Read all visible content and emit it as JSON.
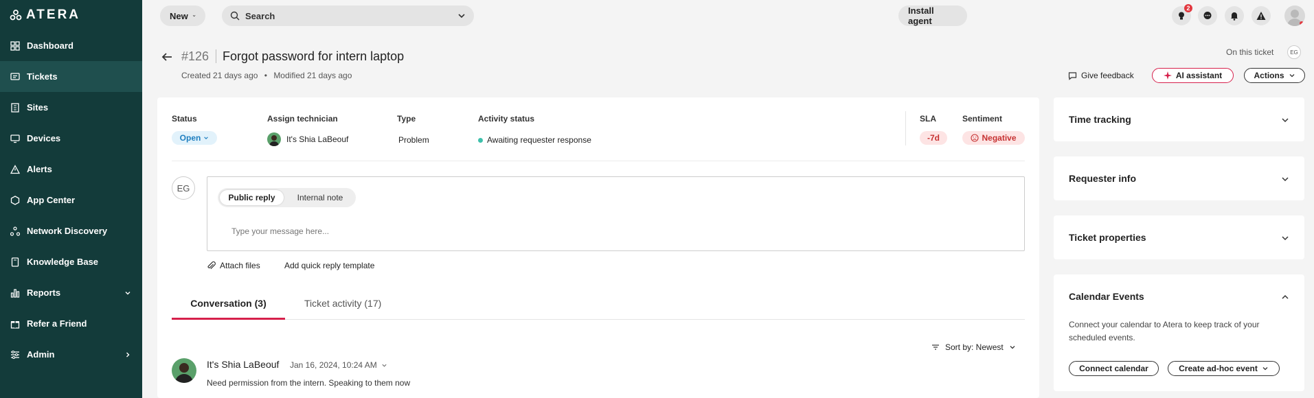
{
  "sidebar": {
    "logo_text": "ATERA",
    "items": [
      {
        "label": "Dashboard",
        "icon": "dashboard-icon"
      },
      {
        "label": "Tickets",
        "icon": "ticket-icon",
        "active": true
      },
      {
        "label": "Sites",
        "icon": "building-icon"
      },
      {
        "label": "Devices",
        "icon": "monitor-icon"
      },
      {
        "label": "Alerts",
        "icon": "alert-icon"
      },
      {
        "label": "App Center",
        "icon": "app-center-icon"
      },
      {
        "label": "Network Discovery",
        "icon": "network-icon"
      },
      {
        "label": "Knowledge Base",
        "icon": "book-icon"
      },
      {
        "label": "Reports",
        "icon": "chart-icon"
      },
      {
        "label": "Refer a Friend",
        "icon": "gift-icon"
      },
      {
        "label": "Admin",
        "icon": "sliders-icon"
      }
    ]
  },
  "topbar": {
    "new_label": "New",
    "search_placeholder": "Search",
    "install_agent_label": "Install agent",
    "notifications_badge": "2"
  },
  "ticket": {
    "number": "#126",
    "title": "Forgot password for intern laptop",
    "created": "Created 21 days ago",
    "modified": "Modified 21 days ago",
    "on_this_ticket": "On this ticket",
    "viewer_initials": "EG",
    "give_feedback": "Give feedback",
    "ai_assistant": "AI assistant",
    "actions": "Actions"
  },
  "fields": {
    "status_label": "Status",
    "status_value": "Open",
    "tech_label": "Assign technician",
    "tech_value": "It's Shia LaBeouf",
    "type_label": "Type",
    "type_value": "Problem",
    "activity_label": "Activity status",
    "activity_value": "Awaiting requester response",
    "sla_label": "SLA",
    "sla_value": "-7d",
    "sentiment_label": "Sentiment",
    "sentiment_value": "Negative"
  },
  "reply": {
    "user_initials": "EG",
    "tab_public": "Public reply",
    "tab_internal": "Internal note",
    "placeholder": "Type your message here...",
    "attach_files": "Attach files",
    "quick_template": "Add quick reply template"
  },
  "conversation": {
    "tab_conversation": "Conversation (3)",
    "tab_activity": "Ticket activity (17)",
    "sort_label": "Sort by: Newest",
    "message": {
      "author": "It's Shia LaBeouf",
      "date": "Jan 16, 2024, 10:24 AM",
      "text": "Need permission from the intern. Speaking to them now"
    }
  },
  "side_panels": {
    "time_tracking": "Time tracking",
    "requester_info": "Requester info",
    "ticket_properties": "Ticket properties",
    "calendar_events": "Calendar Events",
    "calendar_text": "Connect your calendar to Atera to keep track of your scheduled events.",
    "connect_calendar": "Connect calendar",
    "create_event": "Create ad-hoc event"
  }
}
